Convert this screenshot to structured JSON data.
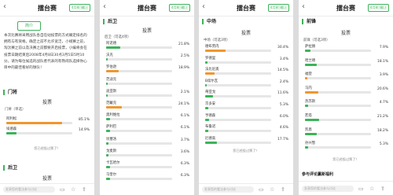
{
  "header": {
    "back_icon": "chevron-left-icon",
    "title": "擂台赛",
    "badge": "4月8日截止"
  },
  "panel1": {
    "intro_button": "简介",
    "intro_text": "本次比赛将采用战队各自在站投票的方式确定排名的拥有与有资格。确定之前不允许宽泛，小规赛之前，淘汰赛之前以及决赛之前都要开启投票，小编将会在投票日期结束后2008年4月8日30点3月5日5时10分。请为每位候选的战队者代表的有熟闹队选择你心目中的最佳看好的球队！",
    "section1": "门将",
    "vote_title": "投票",
    "limit": "门将（单选）",
    "options": [
      {
        "name": "阿利松",
        "pct": "85.1%",
        "value": 85.1,
        "color": "#f0962e"
      },
      {
        "name": "埃德森",
        "pct": "14.9%",
        "value": 14.9,
        "color": "#3cb35a"
      }
    ],
    "hint": "您已经投过票了！",
    "section2": "后卫",
    "section2_vote": "投票"
  },
  "panel2": {
    "section": "后卫",
    "vote_title": "投票",
    "limit": "后卫（可选4项）",
    "options": [
      {
        "name": "阿诺德",
        "pct": "21.8%",
        "value": 21.8,
        "color": "#3cb35a"
      },
      {
        "name": "沃克",
        "pct": "2.5%",
        "value": 2.5,
        "color": "#3cb35a"
      },
      {
        "name": "罗伯逊",
        "pct": "18.9%",
        "value": 18.9,
        "color": "#f0962e"
      },
      {
        "name": "范迪克",
        "pct": "",
        "value": 2.0,
        "color": "#3cb35a"
      },
      {
        "name": "迪亚斯",
        "pct": "2.1%",
        "value": 2.1,
        "color": "#3cb35a"
      },
      {
        "name": "范戴克",
        "pct": "24.1%",
        "value": 24.1,
        "color": "#f0962e"
      },
      {
        "name": "奥利维拉",
        "pct": "6.1%",
        "value": 6.1,
        "color": "#3cb35a"
      },
      {
        "name": "萨利巴",
        "pct": "6.1%",
        "value": 6.1,
        "color": "#3cb35a"
      },
      {
        "name": "坎塞洛",
        "pct": "3.7%",
        "value": 3.7,
        "color": "#3cb35a"
      },
      {
        "name": "戈麦斯",
        "pct": "3.6%",
        "value": 3.6,
        "color": "#3cb35a"
      },
      {
        "name": "卡瓦哈尔",
        "pct": "6.3%",
        "value": 6.3,
        "color": "#3cb35a"
      },
      {
        "name": "马奎尔",
        "pct": "6.3%",
        "value": 6.3,
        "color": "#3cb35a"
      }
    ]
  },
  "panel3": {
    "section": "中场",
    "vote_title": "投票",
    "limit": "中场（可选3项）",
    "options": [
      {
        "name": "德布劳内",
        "pct": "30.4%",
        "value": 30.4,
        "color": "#f0962e"
      },
      {
        "name": "罗德里",
        "pct": "3.4%",
        "value": 3.4,
        "color": "#3cb35a"
      },
      {
        "name": "法比尼奥",
        "pct": "14.5%",
        "value": 14.5,
        "color": "#f0962e"
      },
      {
        "name": "B席尔瓦",
        "pct": "2.4%",
        "value": 2.4,
        "color": "#3cb35a"
      },
      {
        "name": "蒂亚戈",
        "pct": "11.6%",
        "value": 11.6,
        "color": "#3cb35a"
      },
      {
        "name": "京多安",
        "pct": "5.3%",
        "value": 5.3,
        "color": "#3cb35a"
      },
      {
        "name": "亨德森",
        "pct": "6.0%",
        "value": 6.0,
        "color": "#3cb35a"
      },
      {
        "name": "布鲁诺",
        "pct": "4.6%",
        "value": 4.6,
        "color": "#3cb35a"
      },
      {
        "name": "厄德高",
        "pct": "17.7%",
        "value": 17.7,
        "color": "#3cb35a"
      }
    ],
    "hint": "您已经投过票了！"
  },
  "panel4": {
    "section": "前锋",
    "vote_title": "投票",
    "limit": "前锋（可选3项）",
    "options": [
      {
        "name": "萨拉赫",
        "pct": "7.9%",
        "value": 7.9,
        "color": "#3cb35a"
      },
      {
        "name": "哈兰德",
        "pct": "18.1%",
        "value": 18.1,
        "color": "#3cb35a"
      },
      {
        "name": "福登",
        "pct": "3.9%",
        "value": 3.9,
        "color": "#f0962e"
      },
      {
        "name": "马内",
        "pct": "20.6%",
        "value": 20.6,
        "color": "#f0962e"
      },
      {
        "name": "热苏斯",
        "pct": "4.7%",
        "value": 4.7,
        "color": "#3cb35a"
      },
      {
        "name": "若塔",
        "pct": "21.2%",
        "value": 21.2,
        "color": "#3cb35a"
      },
      {
        "name": "凯恩",
        "pct": "18.2%",
        "value": 18.2,
        "color": "#3cb35a"
      },
      {
        "name": "孙兴慜",
        "pct": "5.3%",
        "value": 5.3,
        "color": "#3cb35a"
      }
    ],
    "hint": "您已经投过票了！",
    "comments_label": "参与评论赢新福利"
  },
  "footer": {
    "comment_placeholder": "发表您的看法参与讨论",
    "icons": [
      "comment-icon",
      "star-icon",
      "share-icon"
    ]
  }
}
